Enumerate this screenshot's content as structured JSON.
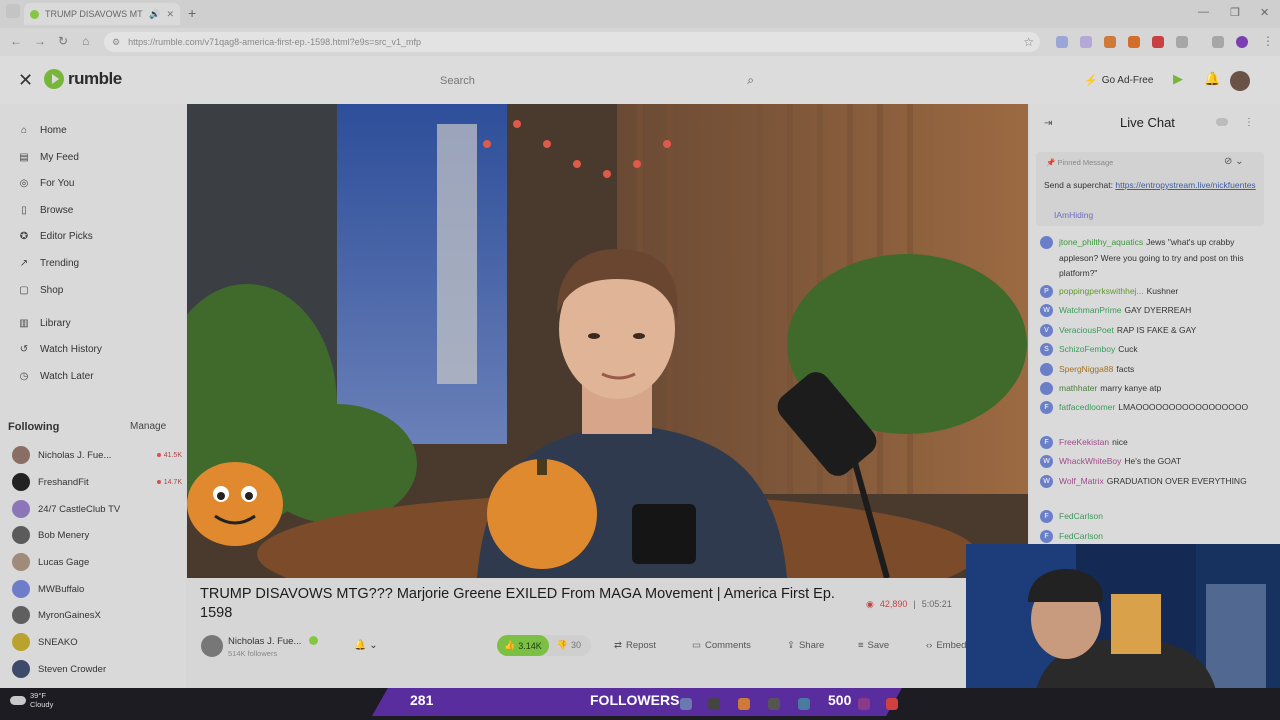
{
  "browser": {
    "tab_title": "TRUMP DISAVOWS MTG???",
    "url": "https://rumble.com/v71qag8-america-first-ep.-1598.html?e9s=src_v1_mfp"
  },
  "header": {
    "logo_text": "rumble",
    "search_placeholder": "Search",
    "go_ad_free": "Go Ad-Free"
  },
  "sidebar": {
    "nav": [
      {
        "label": "Home",
        "icon": "home-icon"
      },
      {
        "label": "My Feed",
        "icon": "feed-icon"
      },
      {
        "label": "For You",
        "icon": "target-icon"
      },
      {
        "label": "Browse",
        "icon": "browse-icon"
      },
      {
        "label": "Editor Picks",
        "icon": "ribbon-icon"
      },
      {
        "label": "Trending",
        "icon": "trending-icon"
      },
      {
        "label": "Shop",
        "icon": "shop-icon"
      },
      {
        "label": "Library",
        "icon": "library-icon"
      },
      {
        "label": "Watch History",
        "icon": "history-icon"
      },
      {
        "label": "Watch Later",
        "icon": "clock-icon"
      }
    ],
    "following_title": "Following",
    "manage_label": "Manage",
    "following": [
      {
        "name": "Nicholas J. Fue...",
        "live": "41.5K"
      },
      {
        "name": "FreshandFit",
        "live": "14.7K"
      },
      {
        "name": "24/7 CastleClub TV",
        "live": ""
      },
      {
        "name": "Bob Menery",
        "live": ""
      },
      {
        "name": "Lucas Gage",
        "live": ""
      },
      {
        "name": "MWBuffalo",
        "live": ""
      },
      {
        "name": "MyronGainesX",
        "live": ""
      },
      {
        "name": "SNEAKO",
        "live": ""
      },
      {
        "name": "Steven Crowder",
        "live": ""
      }
    ]
  },
  "video": {
    "title": "TRUMP DISAVOWS MTG??? Marjorie Greene EXILED From MAGA Movement | America First Ep. 1598",
    "viewers": "42,890",
    "duration": "5:05:21",
    "channel_name": "Nicholas J. Fue...",
    "channel_followers": "514K followers",
    "likes": "3.14K",
    "dislikes": "30",
    "repost_label": "Repost",
    "comments_label": "Comments",
    "share_label": "Share",
    "save_label": "Save",
    "embed_label": "Embed"
  },
  "chat": {
    "title": "Live Chat",
    "pinned_label": "Pinned Message",
    "pinned_text": "Send a superchat: ",
    "pinned_link": "https://entropystream.live/nickfuentes",
    "pinned_user": "IAmHiding",
    "messages": [
      {
        "user": "jtone_philthy_aquatics",
        "text": "Jews \"what's up crabby appleson? Were you going to try and post on this platform?\"",
        "color": "#3a9a3a",
        "initial": ""
      },
      {
        "user": "poppingperkswithhej...",
        "text": "Kushner",
        "color": "#5f9a2e",
        "initial": "P"
      },
      {
        "user": "WatchmanPrime",
        "text": "GAY DYERREAH",
        "color": "#3a9a5a",
        "initial": "W"
      },
      {
        "user": "VeraciousPoet",
        "text": "RAP IS FAKE & GAY",
        "color": "#3a9a5a",
        "initial": "V"
      },
      {
        "user": "SchizoFemboy",
        "text": "Cuck",
        "color": "#3a9a5a",
        "initial": "S"
      },
      {
        "user": "SpergNigga88",
        "text": "facts",
        "color": "#a07020",
        "initial": ""
      },
      {
        "user": "mathhater",
        "text": "marry kanye atp",
        "color": "#4a7a3a",
        "initial": ""
      },
      {
        "user": "fatfacedloomer",
        "text": "LMAOOOOOOOOOOOOOOOOO",
        "color": "#3a9a5a",
        "initial": "F"
      },
      {
        "user": "FreeKekistan",
        "text": "nice",
        "color": "#a04a8a",
        "initial": "F"
      },
      {
        "user": "WhackWhiteBoy",
        "text": "He's the GOAT",
        "color": "#a04a8a",
        "initial": "W"
      },
      {
        "user": "Wolf_Matrix",
        "text": "GRADUATION OVER EVERYTHING",
        "color": "#a04a8a",
        "initial": "W"
      },
      {
        "user": "FedCarlson",
        "text": "",
        "color": "#3a9a5a",
        "initial": "F"
      },
      {
        "user": "FedCarlson",
        "text": "",
        "color": "#3a9a5a",
        "initial": "F"
      }
    ]
  },
  "overlay": {
    "left_number": "281",
    "label": "FOLLOWERS",
    "right_number": "500"
  },
  "taskbar": {
    "temp": "39°F",
    "weather": "Cloudy"
  }
}
